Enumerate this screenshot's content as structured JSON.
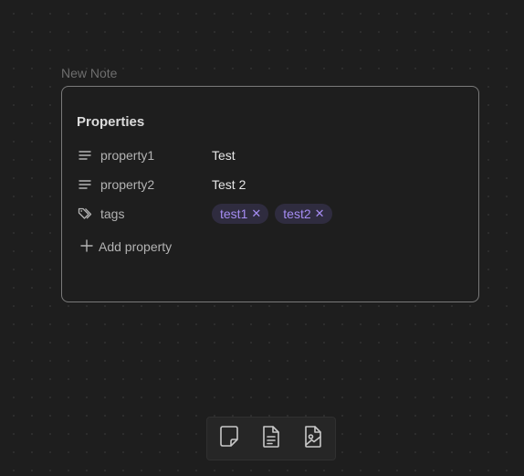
{
  "node": {
    "label": "New Note"
  },
  "properties": {
    "heading": "Properties",
    "rows": [
      {
        "icon": "text-lines-icon",
        "key": "property1",
        "value": "Test"
      },
      {
        "icon": "text-lines-icon",
        "key": "property2",
        "value": "Test 2"
      },
      {
        "icon": "tags-icon",
        "key": "tags",
        "tags": [
          "test1",
          "test2"
        ]
      }
    ],
    "add_label": "Add property",
    "add_icon": "plus-icon"
  },
  "toolbar": {
    "items": [
      {
        "icon": "blank-note-icon"
      },
      {
        "icon": "file-text-icon"
      },
      {
        "icon": "image-file-icon"
      }
    ]
  },
  "colors": {
    "background": "#1e1e1e",
    "card_border": "#7a7a7a",
    "tag_bg": "#2f2c3f",
    "tag_text": "#a58cf2",
    "muted_text": "#b3b3b3"
  }
}
